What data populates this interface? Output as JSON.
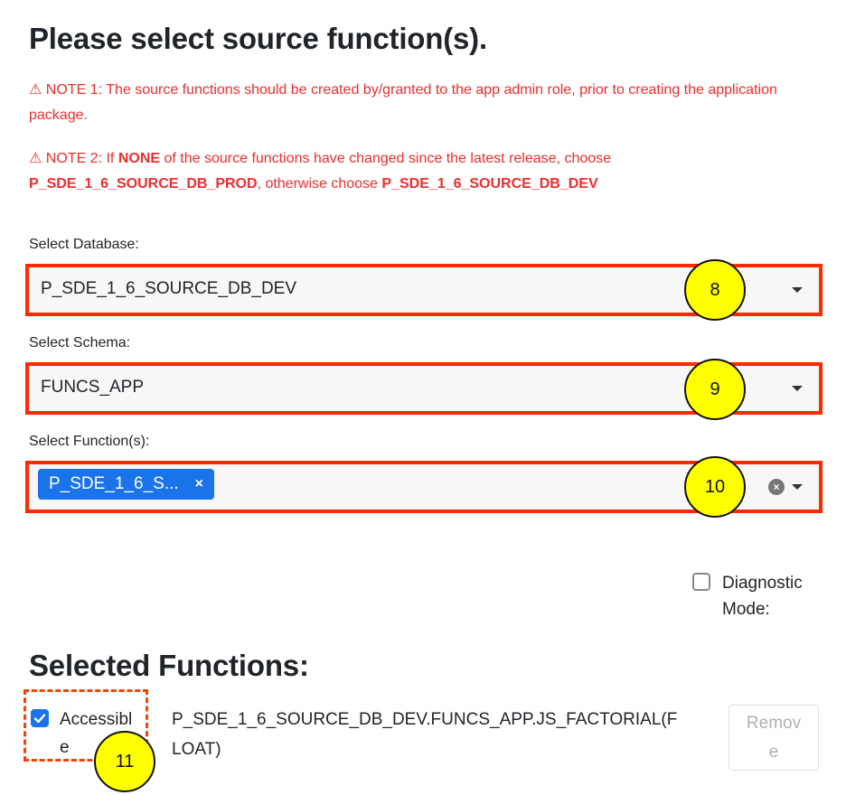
{
  "page": {
    "title": "Please select source function(s).",
    "note1": "⚠ NOTE 1: The source functions should be created by/granted to the app admin role, prior to creating the application package.",
    "note2": {
      "prefix": "⚠ NOTE 2: If ",
      "none": "NONE",
      "middle": " of the source functions have changed since the latest release, choose ",
      "prod_db": "P_SDE_1_6_SOURCE_DB_PROD",
      "otherwise": ", otherwise choose ",
      "dev_db": "P_SDE_1_6_SOURCE_DB_DEV"
    }
  },
  "database": {
    "label": "Select Database:",
    "value": "P_SDE_1_6_SOURCE_DB_DEV",
    "marker": "8"
  },
  "schema": {
    "label": "Select Schema:",
    "value": "FUNCS_APP",
    "marker": "9"
  },
  "functions": {
    "label": "Select Function(s):",
    "chip": "P_SDE_1_6_S...",
    "chip_remove": "×",
    "clear": "×",
    "marker": "10"
  },
  "diagnostic": {
    "label_line1": "Diagnostic",
    "label_line2": "Mode:",
    "checked": false
  },
  "selected": {
    "heading": "Selected Functions:",
    "row": {
      "accessible_line1": "Accessibl",
      "accessible_line2": "e",
      "checked": true,
      "name_line1": "P_SDE_1_6_SOURCE_DB_DEV.FUNCS_APP.JS_FACTORIAL(F",
      "name_line2": "LOAT)",
      "remove_line1": "Remov",
      "remove_line2": "e",
      "marker": "11"
    }
  },
  "colors": {
    "accent": "#1a73e8",
    "highlight_border": "#ff2a00",
    "note_text": "#f02d2d",
    "marker_fill": "#ffff00"
  }
}
